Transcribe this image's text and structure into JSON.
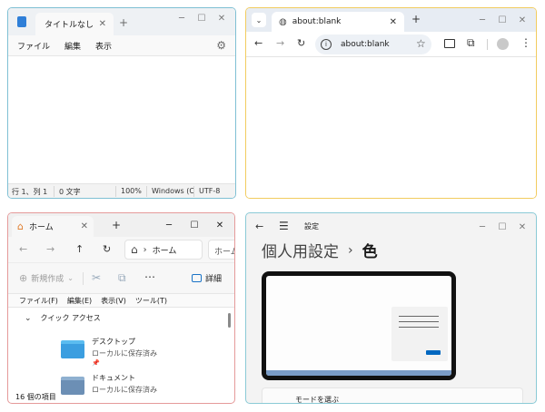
{
  "notepad": {
    "tab_title": "タイトルなし",
    "menu": [
      "ファイル",
      "編集",
      "表示"
    ],
    "status": {
      "position": "行 1、列 1",
      "chars": "0 文字",
      "zoom": "100%",
      "line_ending": "Windows (C",
      "encoding": "UTF-8"
    }
  },
  "browser": {
    "tab_title": "about:blank",
    "address": "about:blank"
  },
  "explorer": {
    "tab_title": "ホーム",
    "breadcrumb": "ホーム",
    "search_placeholder": "ホームの",
    "new_button": "新規作成",
    "details_button": "詳細",
    "menu": [
      "ファイル(F)",
      "編集(E)",
      "表示(V)",
      "ツール(T)"
    ],
    "quick_access": "クイック アクセス",
    "items": [
      {
        "name": "デスクトップ",
        "sub": "ローカルに保存済み"
      },
      {
        "name": "ドキュメント",
        "sub": "ローカルに保存済み"
      }
    ],
    "status": "16 個の項目"
  },
  "settings": {
    "app_title": "設定",
    "heading_parent": "個人用設定",
    "heading_child": "色",
    "mode_label": "モードを選ぶ"
  },
  "colors": {
    "accent": "#0067c0",
    "notepad_border": "#7fc0d4",
    "browser_border": "#f2cc5f",
    "explorer_border": "#e59a9a",
    "settings_border": "#8bcad6"
  }
}
